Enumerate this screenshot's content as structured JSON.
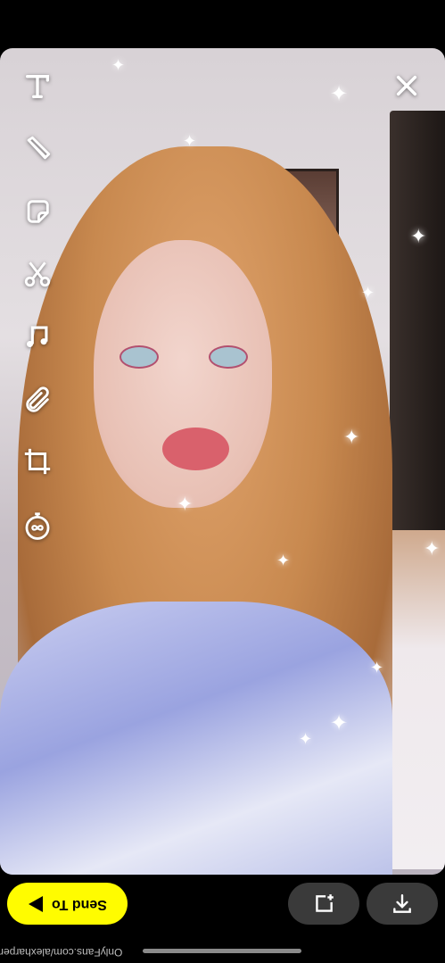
{
  "toolbar": {
    "tools": [
      {
        "name": "text-tool",
        "icon": "text-icon"
      },
      {
        "name": "pencil-tool",
        "icon": "pencil-icon"
      },
      {
        "name": "sticker-tool",
        "icon": "sticker-icon"
      },
      {
        "name": "scissors-tool",
        "icon": "scissors-icon"
      },
      {
        "name": "music-tool",
        "icon": "music-note-icon"
      },
      {
        "name": "attachment-tool",
        "icon": "paperclip-icon"
      },
      {
        "name": "crop-tool",
        "icon": "crop-icon"
      },
      {
        "name": "timer-tool",
        "icon": "timer-infinity-icon"
      }
    ]
  },
  "close": {
    "icon": "close-icon"
  },
  "bottom": {
    "send_label": "Send To",
    "story_icon": "add-to-story-icon",
    "save_icon": "download-icon"
  },
  "watermark": "OnlyFans.com/alexharper",
  "colors": {
    "send_button": "#fffc00",
    "round_button": "#3a3a3a",
    "background": "#000000"
  }
}
